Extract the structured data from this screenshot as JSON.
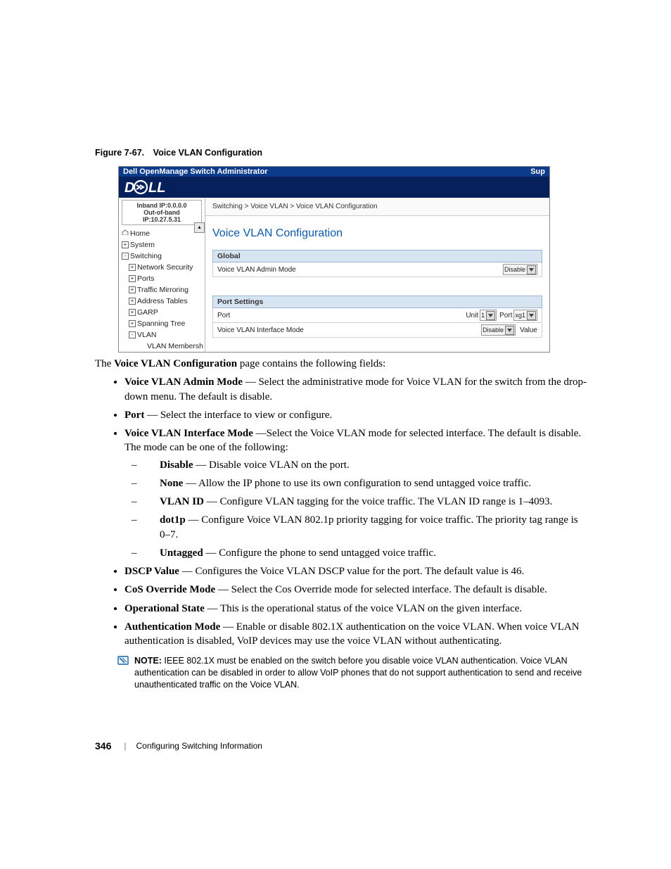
{
  "figure_caption": "Figure 7-67. Voice VLAN Configuration",
  "screenshot": {
    "titlebar_left": "Dell OpenManage Switch Administrator",
    "titlebar_right": "Sup",
    "ip_inband": "Inband IP:0.0.0.0",
    "ip_oob": "Out-of-band IP:10.27.5.31",
    "tree": {
      "home": "Home",
      "system": "System",
      "switching": "Switching",
      "network_security": "Network Security",
      "ports": "Ports",
      "traffic_mirroring": "Traffic Mirroring",
      "address_tables": "Address Tables",
      "garp": "GARP",
      "spanning_tree": "Spanning Tree",
      "vlan": "VLAN",
      "vlan_membersh": "VLAN Membersh"
    },
    "breadcrumb": "Switching > Voice VLAN > Voice VLAN Configuration",
    "page_title": "Voice VLAN Configuration",
    "section_global": "Global",
    "row_admin_mode_label": "Voice VLAN Admin Mode",
    "row_admin_mode_value": "Disable",
    "section_port": "Port Settings",
    "row_port_label": "Port",
    "row_port_unit_label": "Unit",
    "row_port_unit_value": "1",
    "row_port_port_label": "Port",
    "row_port_port_value": "xg1",
    "row_iface_mode_label": "Voice VLAN Interface Mode",
    "row_iface_mode_value": "Disable",
    "row_iface_mode_extra": "Value"
  },
  "intro_1": "The ",
  "intro_b": "Voice VLAN Configuration",
  "intro_2": " page contains the following fields:",
  "bullets": [
    {
      "b": "Voice VLAN Admin Mode",
      "t": " — Select the administrative mode for Voice VLAN for the switch from the drop-down menu. The default is disable."
    },
    {
      "b": "Port",
      "t": " — Select the interface to view or configure."
    },
    {
      "b": "Voice VLAN Interface Mode",
      "t": " —Select the Voice VLAN mode for selected interface. The default is disable. The mode can be one of the following:"
    },
    {
      "b": "DSCP Value",
      "t": " — Configures the Voice VLAN DSCP value for the port. The default value is 46."
    },
    {
      "b": "CoS Override Mode",
      "t": " — Select the Cos Override mode for selected interface. The default is disable."
    },
    {
      "b": "Operational State",
      "t": " — This is the operational status of the voice VLAN on the given interface."
    },
    {
      "b": "Authentication Mode",
      "t": " — Enable or disable 802.1X authentication on the voice VLAN. When voice VLAN authentication is disabled, VoIP devices may use the voice VLAN without authenticating."
    }
  ],
  "sub_bullets": [
    {
      "b": "Disable",
      "t": " — Disable voice VLAN on the port."
    },
    {
      "b": "None",
      "t": " — Allow the IP phone to use its own configuration to send untagged voice traffic."
    },
    {
      "b": "VLAN ID",
      "t": " — Configure VLAN tagging for the voice traffic. The VLAN ID range is 1–4093."
    },
    {
      "b": "dot1p",
      "t": " — Configure Voice VLAN 802.1p priority tagging for voice traffic. The priority tag range is 0–7."
    },
    {
      "b": "Untagged",
      "t": " —   Configure the phone to send untagged voice traffic."
    }
  ],
  "note_label": "NOTE: ",
  "note_text": "IEEE 802.1X must be enabled on the switch before you disable voice VLAN authentication. Voice VLAN authentication can be disabled in order to allow VoIP phones that do not support authentication to send and receive unauthenticated traffic on the Voice VLAN.",
  "footer_page": "346",
  "footer_text": "Configuring Switching Information"
}
